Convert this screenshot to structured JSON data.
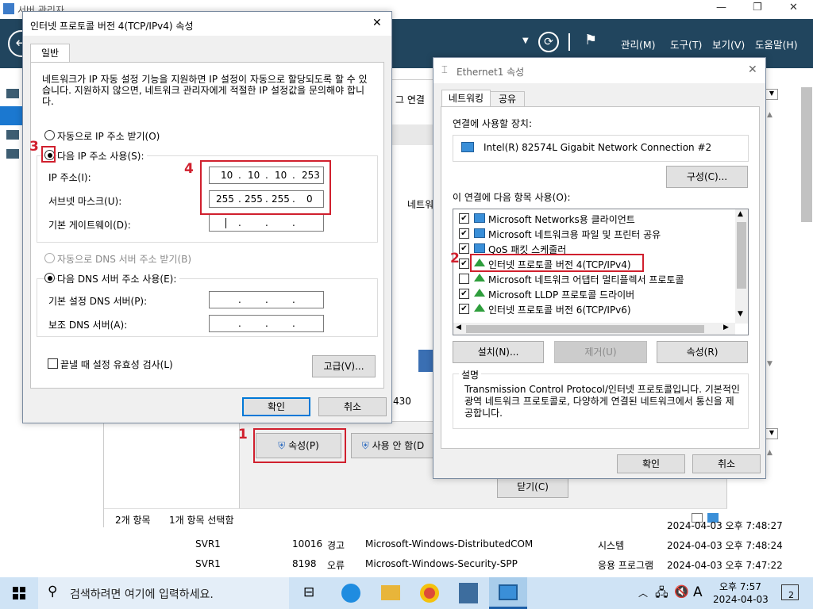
{
  "server_manager": {
    "title": "서버 관리자",
    "menu": {
      "manage": "관리(M)",
      "tools": "도구(T)",
      "view": "보기(V)",
      "help": "도움말(H)"
    },
    "bg_text": {
      "tab_fragment": "ㅣ그 연결",
      "network_label": "네트워크",
      "number": "430"
    },
    "adapter_buttons": {
      "properties": "속성(P)",
      "disable": "사용 안 함(D"
    },
    "close_button": "닫기(C)",
    "status": {
      "count": "2개 항목",
      "selected": "1개 항목 선택함"
    },
    "events": [
      {
        "server": "",
        "id": "",
        "level": "",
        "source": "",
        "log": "",
        "date": "2024-04-03 오후 7:48:27"
      },
      {
        "server": "SVR1",
        "id": "10016",
        "level": "경고",
        "source": "Microsoft-Windows-DistributedCOM",
        "log": "시스템",
        "date": "2024-04-03 오후 7:48:24"
      },
      {
        "server": "SVR1",
        "id": "8198",
        "level": "오류",
        "source": "Microsoft-Windows-Security-SPP",
        "log": "응용 프로그램",
        "date": "2024-04-03 오후 7:47:22"
      }
    ]
  },
  "ipv4_dialog": {
    "title": "인터넷 프로토콜 버전 4(TCP/IPv4) 속성",
    "tab": "일반",
    "description": "네트워크가 IP 자동 설정 기능을 지원하면 IP 설정이 자동으로 할당되도록 할 수 있습니다. 지원하지 않으면, 네트워크 관리자에게 적절한 IP 설정값을 문의해야 합니다.",
    "auto_ip": "자동으로 IP 주소 받기(O)",
    "manual_ip": "다음 IP 주소 사용(S):",
    "ip_label": "IP 주소(I):",
    "mask_label": "서브넷 마스크(U):",
    "gateway_label": "기본 게이트웨이(D):",
    "ip": [
      "10",
      "10",
      "10",
      "253"
    ],
    "mask": [
      "255",
      "255",
      "255",
      "0"
    ],
    "auto_dns": "자동으로 DNS 서버 주소 받기(B)",
    "manual_dns": "다음 DNS 서버 주소 사용(E):",
    "dns1_label": "기본 설정 DNS 서버(P):",
    "dns2_label": "보조 DNS 서버(A):",
    "validate": "끝낼 때 설정 유효성 검사(L)",
    "advanced": "고급(V)...",
    "ok": "확인",
    "cancel": "취소"
  },
  "eth_dialog": {
    "title": "Ethernet1 속성",
    "tabs": [
      "네트워킹",
      "공유"
    ],
    "connect_using": "연결에 사용할 장치:",
    "adapter": "Intel(R) 82574L Gigabit Network Connection #2",
    "configure": "구성(C)...",
    "items_label": "이 연결에 다음 항목 사용(O):",
    "items": [
      {
        "label": "Microsoft Networks용 클라이언트",
        "checked": true,
        "icon": "network-client-icon"
      },
      {
        "label": "Microsoft 네트워크용 파일 및 프린터 공유",
        "checked": true,
        "icon": "network-service-icon"
      },
      {
        "label": "QoS 패킷 스케줄러",
        "checked": true,
        "icon": "network-service-icon"
      },
      {
        "label": "인터넷 프로토콜 버전 4(TCP/IPv4)",
        "checked": true,
        "icon": "protocol-icon"
      },
      {
        "label": "Microsoft 네트워크 어댑터 멀티플렉서 프로토콜",
        "checked": false,
        "icon": "protocol-icon"
      },
      {
        "label": "Microsoft LLDP 프로토콜 드라이버",
        "checked": true,
        "icon": "protocol-icon"
      },
      {
        "label": "인터넷 프로토콜 버전 6(TCP/IPv6)",
        "checked": true,
        "icon": "protocol-icon"
      }
    ],
    "install": "설치(N)...",
    "uninstall": "제거(U)",
    "properties": "속성(R)",
    "desc_title": "설명",
    "desc_text": "Transmission Control Protocol/인터넷 프로토콜입니다. 기본적인 광역 네트워크 프로토콜로, 다양하게 연결된 네트워크에서 통신을 제공합니다.",
    "ok": "확인",
    "cancel": "취소"
  },
  "annotations": [
    "1",
    "2",
    "3",
    "4"
  ],
  "taskbar": {
    "search_placeholder": "검색하려면 여기에 입력하세요.",
    "ime": "A",
    "time": "오후 7:57",
    "date": "2024-04-03",
    "notif_count": "2"
  },
  "colors": {
    "titlebar": "#21455e",
    "highlight": "#d0202e",
    "accent": "#0078d7"
  }
}
